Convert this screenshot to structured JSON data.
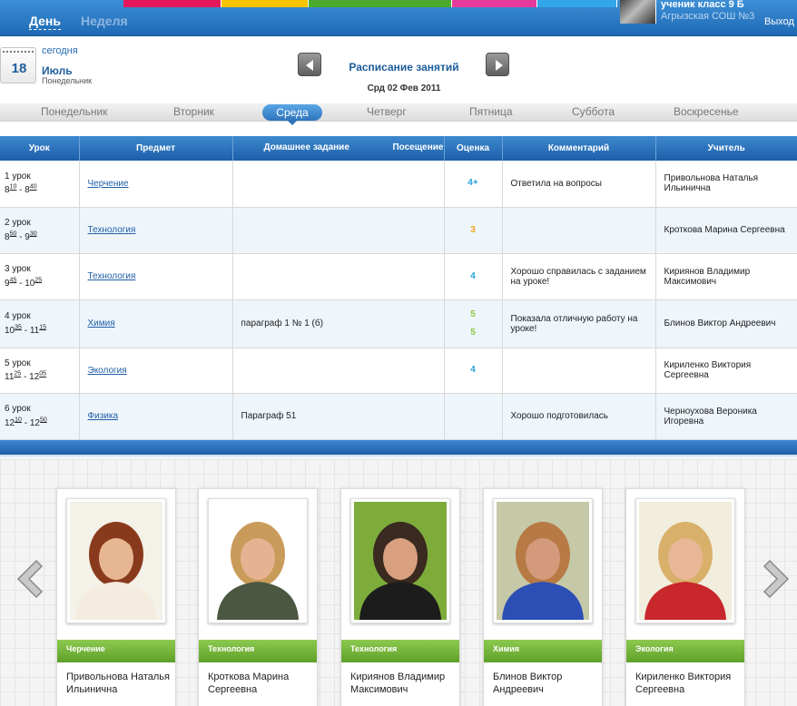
{
  "topbar": {
    "tab_day": "День",
    "tab_week": "Неделя",
    "user_role": "ученик класс 9 Б",
    "school": "Агрызская СОШ №3",
    "logout": "Выход",
    "strip_colors": [
      "#e6185c",
      "#f6c400",
      "#4caa2c",
      "#e63b9b",
      "#32a6e8"
    ]
  },
  "date": {
    "today_link": "сегодня",
    "day_number": "18",
    "month": "Июль",
    "weekday": "Понедельник"
  },
  "header": {
    "title": "Расписание занятий",
    "date": "Срд 02 Фев 2011"
  },
  "weekdays": [
    "Понедельник",
    "Вторник",
    "Среда",
    "Четверг",
    "Пятница",
    "Суббота",
    "Воскресенье"
  ],
  "active_weekday_index": 2,
  "table": {
    "headers": {
      "lesson": "Урок",
      "subject": "Предмет",
      "homework": "Домашнее задание",
      "attendance": "Посещение",
      "grade": "Оценка",
      "comment": "Комментарий",
      "teacher": "Учитель"
    },
    "rows": [
      {
        "lesson": "1 урок",
        "t1h": "8",
        "t1m": "10",
        "t2h": "8",
        "t2m": "40",
        "subject": "Черчение",
        "homework": "",
        "grades": [
          "4+"
        ],
        "grade_colors": [
          "#2aa2dc"
        ],
        "comment": "Ответила на вопросы",
        "teacher": "Привольнова Наталья Ильинична"
      },
      {
        "lesson": "2 урок",
        "t1h": "8",
        "t1m": "50",
        "t2h": "9",
        "t2m": "30",
        "subject": "Технология",
        "homework": "",
        "grades": [
          "3"
        ],
        "grade_colors": [
          "#f5a11c"
        ],
        "comment": "",
        "teacher": "Кроткова Марина Сергеевна"
      },
      {
        "lesson": "3 урок",
        "t1h": "9",
        "t1m": "45",
        "t2h": "10",
        "t2m": "25",
        "subject": "Технология",
        "homework": "",
        "grades": [
          "4"
        ],
        "grade_colors": [
          "#2aa2dc"
        ],
        "comment": "Хорошо справилась с заданием на уроке!",
        "teacher": "Кириянов Владимир Максимович"
      },
      {
        "lesson": "4 урок",
        "t1h": "10",
        "t1m": "35",
        "t2h": "11",
        "t2m": "15",
        "subject": "Химия",
        "homework": "параграф 1 № 1 (б)",
        "grades": [
          "5",
          "5"
        ],
        "grade_colors": [
          "#8cc73f",
          "#8cc73f"
        ],
        "comment": "Показала отличную работу на уроке!",
        "teacher": "Блинов Виктор Андреевич"
      },
      {
        "lesson": "5 урок",
        "t1h": "11",
        "t1m": "25",
        "t2h": "12",
        "t2m": "05",
        "subject": "Экология",
        "homework": "",
        "grades": [
          "4"
        ],
        "grade_colors": [
          "#2aa2dc"
        ],
        "comment": "",
        "teacher": "Кириленко Виктория Сергеевна"
      },
      {
        "lesson": "6 урок",
        "t1h": "12",
        "t1m": "10",
        "t2h": "12",
        "t2m": "50",
        "subject": "Физика",
        "homework": "Параграф 51",
        "grades": [],
        "grade_colors": [],
        "comment": "Хорошо подготовилась",
        "teacher": "Черноухова Вероника Игоревна"
      }
    ]
  },
  "teachers": [
    {
      "subject": "Черчение",
      "name": "Привольнова Наталья Ильинична"
    },
    {
      "subject": "Технология",
      "name": "Кроткова Марина Сергеевна"
    },
    {
      "subject": "Технология",
      "name": "Кириянов Владимир Максимович"
    },
    {
      "subject": "Химия",
      "name": "Блинов Виктор Андреевич"
    },
    {
      "subject": "Экология",
      "name": "Кириленко Виктория Сергеевна"
    }
  ]
}
